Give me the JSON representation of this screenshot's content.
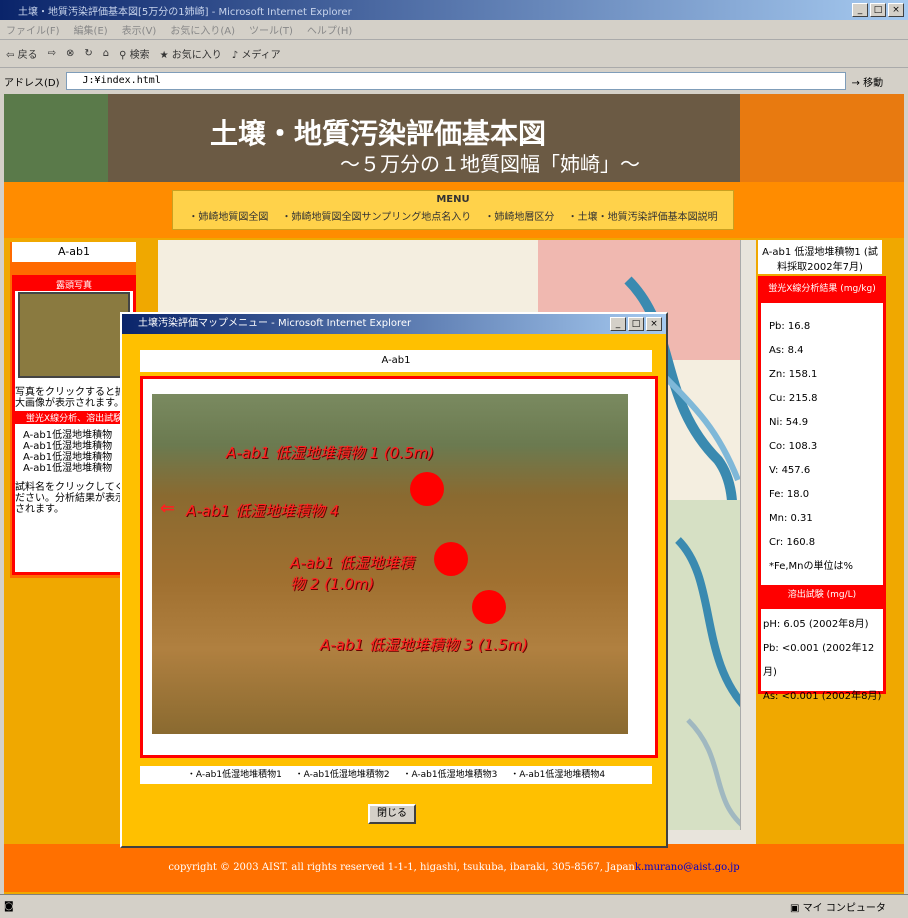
{
  "window": {
    "title": "土壌・地質汚染評価基本図[5万分の1姉崎] - Microsoft Internet Explorer"
  },
  "menu": [
    "ファイル(F)",
    "編集(E)",
    "表示(V)",
    "お気に入り(A)",
    "ツール(T)",
    "ヘルプ(H)"
  ],
  "toolbar": {
    "back": "戻る",
    "search": "検索",
    "favorites": "お気に入り",
    "media": "メディア"
  },
  "address": {
    "label": "アドレス(D)",
    "value": "J:¥index.html",
    "go": "移動"
  },
  "banner": {
    "title": "土壌・地質汚染評価基本図",
    "subtitle": "～５万分の１地質図幅「姉崎」～"
  },
  "nav": {
    "title": "MENU",
    "links": [
      "・姉崎地質図全図",
      "・姉崎地質図全図サンプリング地点名入り",
      "・姉崎地層区分",
      "・土壌・地質汚染評価基本図説明"
    ]
  },
  "left_panel": {
    "name": "A-ab1",
    "photo_header": "露頭写真",
    "photo_note": "写真をクリックすると拡大画像が表示されます。",
    "analysis_header": "蛍光X線分析、溶出試験",
    "samples": [
      "A-ab1低湿地堆積物",
      "A-ab1低湿地堆積物",
      "A-ab1低湿地堆積物",
      "A-ab1低湿地堆積物"
    ],
    "sample_note": "試料名をクリックしてください。分析結果が表示されます。"
  },
  "right_panel": {
    "title": "A-ab1 低湿地堆積物1 (試料採取2002年7月)",
    "xrf_header": "蛍光X線分析結果 (mg/kg)",
    "xrf": [
      "Pb: 16.8",
      "As: 8.4",
      "Zn: 158.1",
      "Cu: 215.8",
      "Ni: 54.9",
      "Co: 108.3",
      "V: 457.6",
      "Fe: 18.0",
      "Mn: 0.31",
      "Cr: 160.8"
    ],
    "unit_note": "*Fe,Mnの単位は%",
    "elution_header": "溶出試験 (mg/L)",
    "elution": [
      "pH: 6.05 (2002年8月)",
      "Pb: <0.001 (2002年12月)",
      "As: <0.001 (2002年8月)"
    ]
  },
  "popup": {
    "title": "土壌汚染評価マップメニュー - Microsoft Internet Explorer",
    "name": "A-ab1",
    "photo_labels": [
      "A-ab1 低湿地堆積物 1 (0.5m)",
      "A-ab1 低湿地堆積物 4",
      "A-ab1 低湿地堆積物 2 (1.0m)",
      "A-ab1 低湿地堆積物 3 (1.5m)"
    ],
    "links": [
      "・A-ab1低湿地堆積物1",
      "・A-ab1低湿地堆積物2",
      "・A-ab1低湿地堆積物3",
      "・A-ab1低湿地堆積物4"
    ],
    "close": "閉じる"
  },
  "footer": {
    "text": "copyright © 2003 AIST. all rights reserved 1-1-1, higashi, tsukuba, ibaraki, 305-8567, Japan",
    "email": "k.murano@aist.go.jp"
  },
  "status": {
    "zone": "マイ コンピュータ"
  }
}
